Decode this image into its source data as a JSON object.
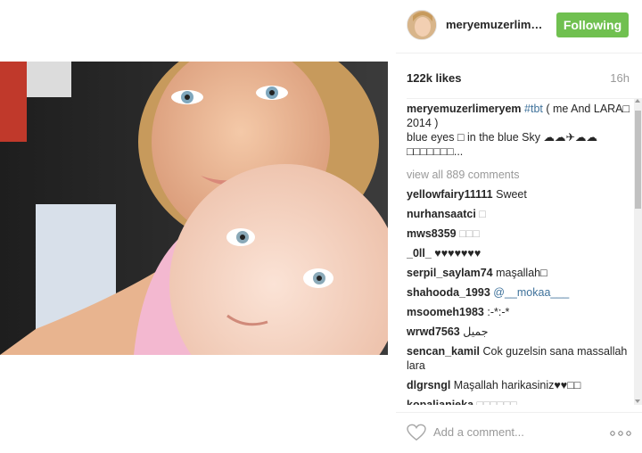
{
  "post": {
    "username": "meryemuzerlimeryem",
    "username_display": "meryemuzerlime...",
    "follow_label": "Following",
    "likes": "122k likes",
    "age": "16h",
    "caption_user": "meryemuzerlimeryem",
    "caption_tag": "#tbt",
    "caption_text": " ( me And LARA□ 2014 )",
    "caption_line2": "blue eyes □ in the blue Sky ☁☁✈☁☁",
    "caption_line3": "□□□□□□□...",
    "view_all": "view all 889 comments",
    "comment_placeholder": "Add a comment...",
    "more_label": "...",
    "comments": [
      {
        "user": "yellowfairy11111",
        "text": "Sweet",
        "mention": ""
      },
      {
        "user": "nurhansaatci",
        "text": "□",
        "mention": ""
      },
      {
        "user": "mws8359",
        "text": "□□□",
        "mention": ""
      },
      {
        "user": "_0ll_",
        "text": "♥♥♥♥♥♥♥",
        "mention": ""
      },
      {
        "user": "serpil_saylam74",
        "text": "maşallah□",
        "mention": ""
      },
      {
        "user": "shahooda_1993",
        "text": "",
        "mention": "@__mokaa___"
      },
      {
        "user": "msoomeh1983",
        "text": ":-*:-*",
        "mention": ""
      },
      {
        "user": "wrwd7563",
        "text": "جميل",
        "mention": ""
      },
      {
        "user": "sencan_kamil",
        "text": "Cok guzelsin sana massallah lara",
        "mention": ""
      },
      {
        "user": "dlgrsngl",
        "text": "Maşallah harikasiniz♥♥□□",
        "mention": ""
      },
      {
        "user": "kopalianieka",
        "text": "□□□□□□",
        "mention": ""
      }
    ]
  },
  "colors": {
    "follow_bg": "#70c050",
    "tag": "#3f729b",
    "muted": "#999999"
  },
  "icons": {
    "like": "heart-icon",
    "more": "more-options-icon",
    "avatar": "profile-avatar"
  }
}
